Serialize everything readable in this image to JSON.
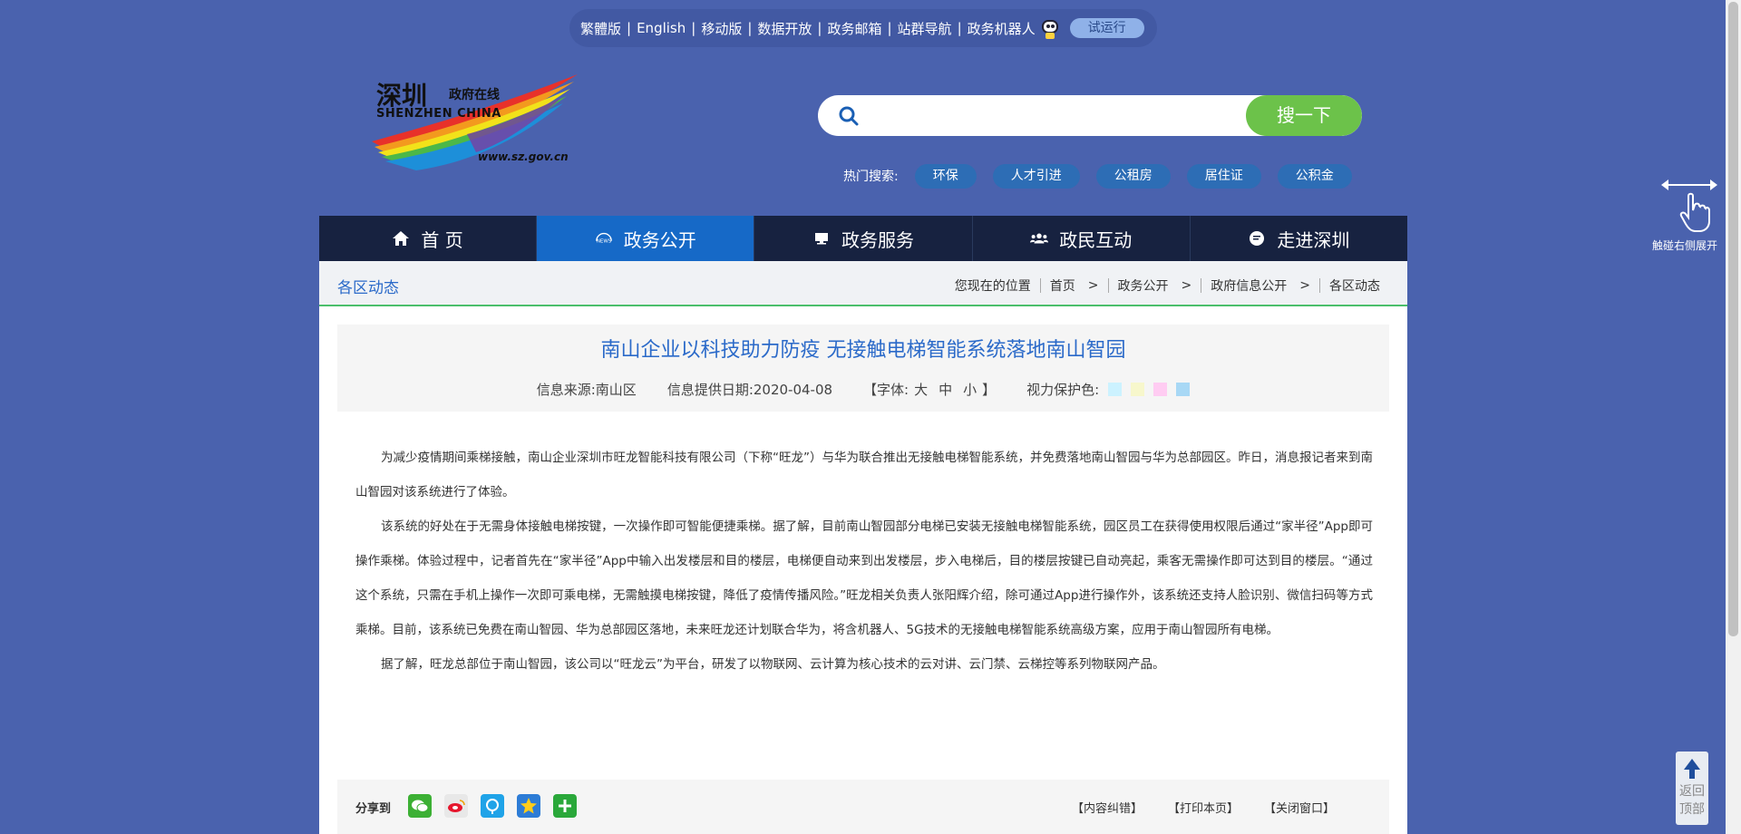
{
  "topbar": {
    "links": [
      "繁體版",
      "English",
      "移动版",
      "数据开放",
      "政务邮箱",
      "站群导航",
      "政务机器人"
    ],
    "trial": "试运行"
  },
  "logo": {
    "cn": "深圳",
    "cn2": "政府在线",
    "en": "SHENZHEN CHINA",
    "url": "www.sz.gov.cn"
  },
  "search": {
    "placeholder": "",
    "button": "搜一下"
  },
  "hot": {
    "label": "热门搜索:",
    "tags": [
      "环保",
      "人才引进",
      "公租房",
      "居住证",
      "公积金"
    ]
  },
  "side_hint": "触碰右侧展开",
  "backtop": [
    "返回",
    "顶部"
  ],
  "nav": [
    {
      "label": "首 页",
      "icon": "home-icon"
    },
    {
      "label": "政务公开",
      "icon": "news-icon",
      "active": true
    },
    {
      "label": "政务服务",
      "icon": "monitor-icon"
    },
    {
      "label": "政民互动",
      "icon": "people-icon"
    },
    {
      "label": "走进深圳",
      "icon": "chat-icon"
    }
  ],
  "section": "各区动态",
  "breadcrumb": {
    "label": "您现在的位置",
    "items": [
      "首页",
      "政务公开",
      "政府信息公开",
      "各区动态"
    ]
  },
  "article": {
    "title": "南山企业以科技助力防疫 无接触电梯智能系统落地南山智园",
    "source": "信息来源:南山区",
    "date": "信息提供日期:2020-04-08",
    "font_label": "【字体:",
    "font_sizes": [
      "大",
      "中",
      "小"
    ],
    "font_end": "】",
    "eye_label": "视力保护色:",
    "eye_colors": [
      "#ccf2ff",
      "#f7f7cc",
      "#ffccf2",
      "#a8d8f5"
    ],
    "paragraphs": [
      "为减少疫情期间乘梯接触，南山企业深圳市旺龙智能科技有限公司（下称“旺龙”）与华为联合推出无接触电梯智能系统，并免费落地南山智园与华为总部园区。昨日，消息报记者来到南山智园对该系统进行了体验。",
      "该系统的好处在于无需身体接触电梯按键，一次操作即可智能便捷乘梯。据了解，目前南山智园部分电梯已安装无接触电梯智能系统，园区员工在获得使用权限后通过“家半径”App即可操作乘梯。体验过程中，记者首先在“家半径”App中输入出发楼层和目的楼层，电梯便自动来到出发楼层，步入电梯后，目的楼层按键已自动亮起，乘客无需操作即可达到目的楼层。“通过这个系统，只需在手机上操作一次即可乘电梯，无需触摸电梯按键，降低了疫情传播风险。”旺龙相关负责人张阳辉介绍，除可通过App进行操作外，该系统还支持人脸识别、微信扫码等方式乘梯。目前，该系统已免费在南山智园、华为总部园区落地，未来旺龙还计划联合华为，将含机器人、5G技术的无接触电梯智能系统高级方案，应用于南山智园所有电梯。",
      "据了解，旺龙总部位于南山智园，该公司以“旺龙云”为平台，研发了以物联网、云计算为核心技术的云对讲、云门禁、云梯控等系列物联网产品。"
    ]
  },
  "share": {
    "label": "分享到",
    "icons": [
      "wechat-icon",
      "weibo-icon",
      "qq-space-icon",
      "favorite-star-icon",
      "more-plus-icon"
    ],
    "actions": [
      "【内容纠错】",
      "【打印本页】",
      "【关闭窗口】"
    ]
  }
}
